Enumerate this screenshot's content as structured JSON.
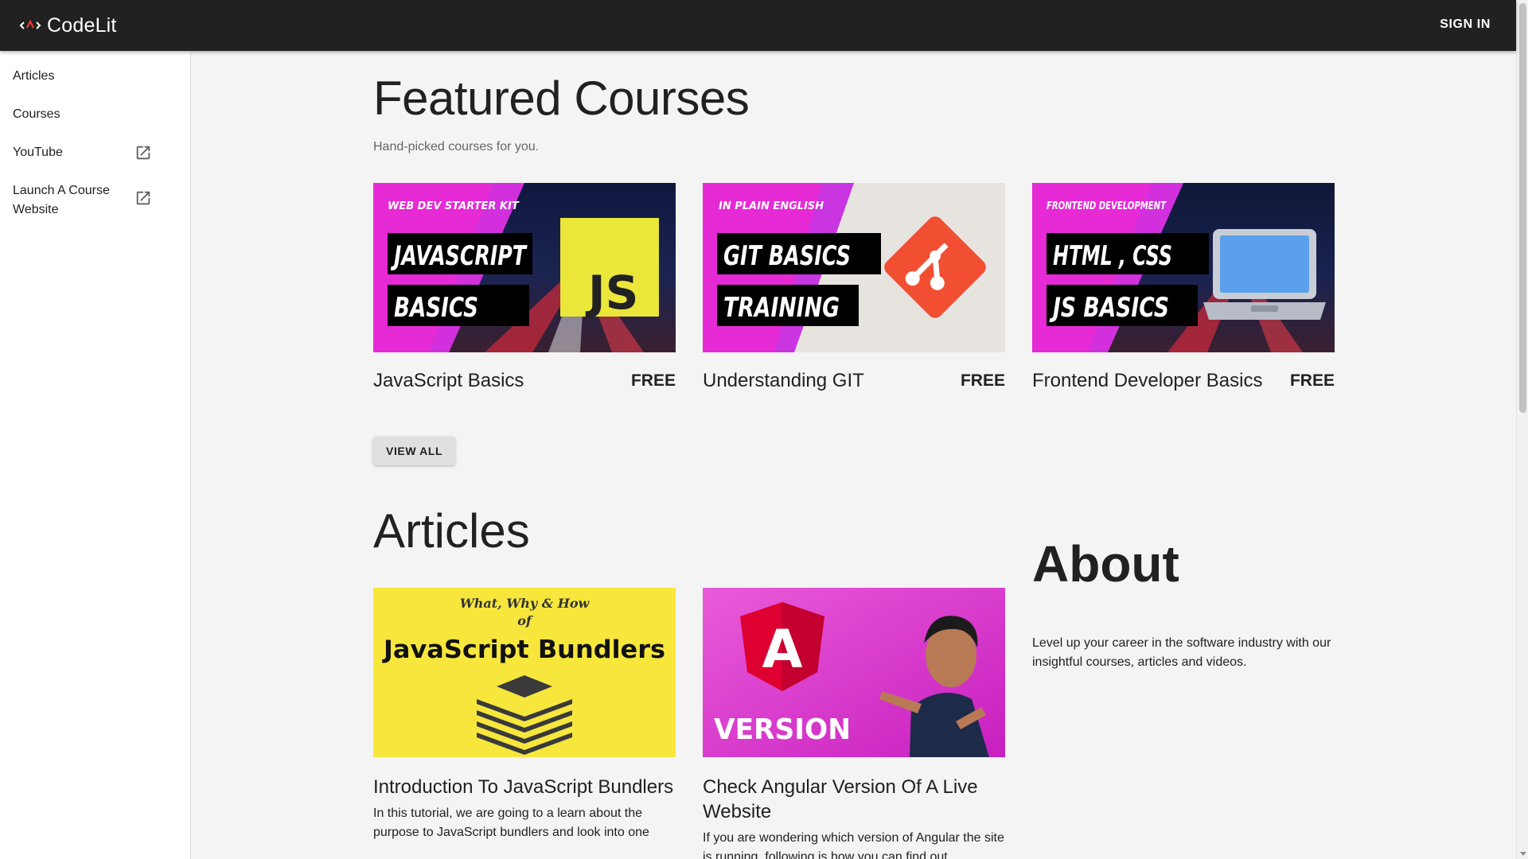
{
  "app": {
    "name": "CodeLit",
    "signin_label": "SIGN IN"
  },
  "sidebar": {
    "items": [
      {
        "label": "Articles",
        "external": false
      },
      {
        "label": "Courses",
        "external": false
      },
      {
        "label": "YouTube",
        "external": true
      },
      {
        "label": "Launch A Course Website",
        "external": true
      }
    ]
  },
  "featured": {
    "title": "Featured Courses",
    "subtitle": "Hand-picked courses for you.",
    "courses": [
      {
        "name": "JavaScript Basics",
        "price": "FREE",
        "thumb": {
          "tag": "WEB DEV STARTER KIT",
          "line1": "JAVASCRIPT",
          "line2": "BASICS",
          "badge": "JS"
        }
      },
      {
        "name": "Understanding GIT",
        "price": "FREE",
        "thumb": {
          "tag": "IN PLAIN ENGLISH",
          "line1": "GIT BASICS",
          "line2": "TRAINING"
        }
      },
      {
        "name": "Frontend Developer Basics",
        "price": "FREE",
        "thumb": {
          "tag": "FRONTEND DEVELOPMENT",
          "line1": "HTML , CSS",
          "line2": "JS BASICS"
        }
      }
    ],
    "view_all_label": "VIEW ALL"
  },
  "articles": {
    "title": "Articles",
    "items": [
      {
        "title": "Introduction To JavaScript Bundlers",
        "description": "In this tutorial, we are going to a learn about the purpose to JavaScript bundlers and look into one",
        "thumb": {
          "script": "What, Why & How",
          "of": "of",
          "headline": "JavaScript Bundlers"
        }
      },
      {
        "title": "Check Angular Version Of A Live Website",
        "description": "If you are wondering which version of Angular the site is running, following is how you can find out.",
        "thumb": {
          "badge": "A",
          "headline": "VERSION"
        }
      }
    ]
  },
  "about": {
    "title": "About",
    "text": "Level up your career in the software industry with our insightful courses, articles and videos."
  },
  "colors": {
    "topbar": "#212121",
    "accent_red": "#e53935",
    "magenta": "#e62ad6",
    "js_yellow": "#ebe63a",
    "git_red": "#f14e32",
    "article_yellow": "#f7e73d",
    "angular_red": "#dd0031"
  },
  "icons": {
    "logo": "code-brackets-icon",
    "external_link": "open-in-new-icon"
  }
}
